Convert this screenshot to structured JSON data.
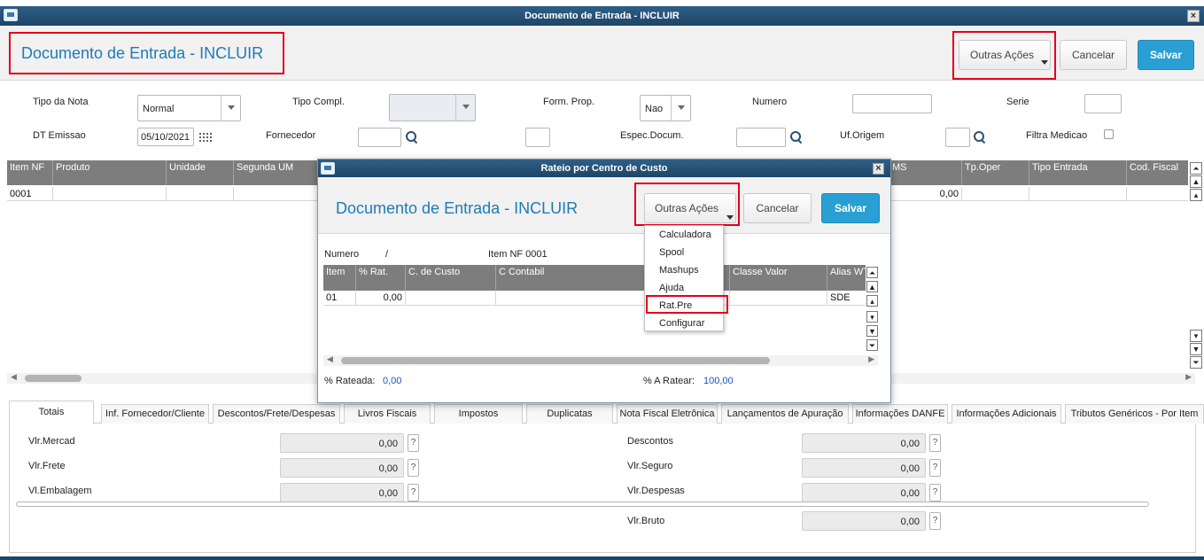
{
  "window": {
    "title": "Documento de Entrada - INCLUIR"
  },
  "header": {
    "title": "Documento de Entrada - INCLUIR",
    "other_actions": "Outras Ações",
    "cancel": "Cancelar",
    "save": "Salvar"
  },
  "form": {
    "tipo_nota": {
      "label": "Tipo da Nota",
      "value": "Normal"
    },
    "tipo_compl": {
      "label": "Tipo Compl.",
      "value": ""
    },
    "form_prop": {
      "label": "Form. Prop.",
      "value": "Nao"
    },
    "numero": {
      "label": "Numero",
      "value": ""
    },
    "serie": {
      "label": "Serie",
      "value": ""
    },
    "dt_emissao": {
      "label": "DT Emissao",
      "value": "05/10/2021"
    },
    "fornecedor": {
      "label": "Fornecedor",
      "value": ""
    },
    "loja": {
      "value": ""
    },
    "espec_docum": {
      "label": "Espec.Docum.",
      "value": ""
    },
    "uf_origem": {
      "label": "Uf.Origem",
      "value": ""
    },
    "filtra_medicao": {
      "label": "Filtra Medicao"
    }
  },
  "items_grid": {
    "columns": [
      "Item NF",
      "Produto",
      "Unidade",
      "Segunda UM",
      "MS",
      "Tp.Oper",
      "Tipo Entrada",
      "Cod. Fiscal"
    ],
    "rows": [
      {
        "item": "0001",
        "value": "0,00"
      }
    ]
  },
  "tabs": [
    "Totais",
    "Inf. Fornecedor/Cliente",
    "Descontos/Frete/Despesas",
    "Livros Fiscais",
    "Impostos",
    "Duplicatas",
    "Nota Fiscal Eletrônica",
    "Lançamentos de Apuração",
    "Informações DANFE",
    "Informações Adicionais",
    "Tributos Genéricos - Por Item"
  ],
  "totals": {
    "vlr_mercad": {
      "label": "Vlr.Mercad",
      "value": "0,00"
    },
    "vlr_frete": {
      "label": "Vlr.Frete",
      "value": "0,00"
    },
    "vl_embalagem": {
      "label": "Vl.Embalagem",
      "value": "0,00"
    },
    "descontos": {
      "label": "Descontos",
      "value": "0,00"
    },
    "vlr_seguro": {
      "label": "Vlr.Seguro",
      "value": "0,00"
    },
    "vlr_despesas": {
      "label": "Vlr.Despesas",
      "value": "0,00"
    },
    "vlr_bruto": {
      "label": "Vlr.Bruto",
      "value": "0,00"
    },
    "help": "?"
  },
  "modal": {
    "title": "Rateio por Centro de Custo",
    "header_title": "Documento de Entrada - INCLUIR",
    "other_actions": "Outras Ações",
    "cancel": "Cancelar",
    "save": "Salvar",
    "numero_label": "Numero",
    "numero_value": "/",
    "item_nf": "Item NF 0001",
    "columns": [
      "Item",
      "% Rat.",
      "C. de Custo",
      "C Contabil",
      "Classe Valor",
      "Alias WT"
    ],
    "row": {
      "item": "01",
      "rat": "0,00",
      "alias": "SDE"
    },
    "rateada_label": "% Rateada:",
    "rateada_value": "0,00",
    "a_ratear_label": "% A Ratear:",
    "a_ratear_value": "100,00",
    "menu": [
      "Calculadora",
      "Spool",
      "Mashups",
      "Ajuda",
      "Rat.Pre",
      "Configurar"
    ]
  },
  "colors": {
    "title_blue": "#1e7bb6",
    "primary_button": "#2a9fd3",
    "highlight_red": "#e1001a",
    "titlebar": "#1e4566"
  }
}
